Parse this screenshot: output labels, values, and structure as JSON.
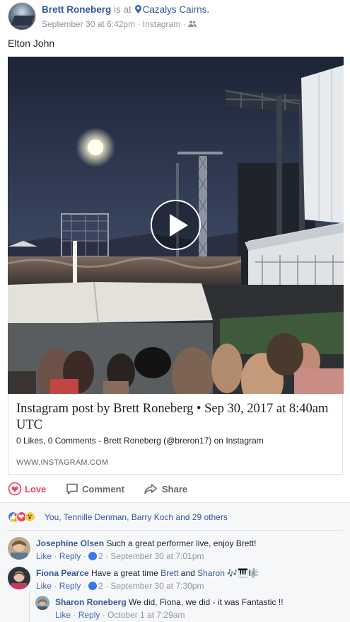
{
  "post": {
    "author": "Brett Roneberg",
    "is_at": "is at",
    "location": "Cazalys Cairns.",
    "time": "September 30 at 6:42pm",
    "via": "Instagram",
    "status_text": "Elton John"
  },
  "attachment": {
    "title": "Instagram post by Brett Roneberg • Sep 30, 2017 at 8:40am UTC",
    "description": "0 Likes, 0 Comments - Brett Roneberg (@breron17) on Instagram",
    "domain": "WWW.INSTAGRAM.COM"
  },
  "actions": {
    "love": "Love",
    "comment": "Comment",
    "share": "Share"
  },
  "reactions": {
    "summary": "You, Tennille Denman, Barry Koch and 29 others"
  },
  "comments": [
    {
      "author": "Josephine Olsen",
      "text": "Such a great performer live, enjoy Brett!",
      "like": "Like",
      "reply": "Reply",
      "likes": "2",
      "time": "September 30 at 7:01pm"
    },
    {
      "author": "Fiona Pearce",
      "text_pre": "Have a great time",
      "mention1": "Brett",
      "and": "and",
      "mention2": "Sharon",
      "notes": "🎶🎹🎼",
      "like": "Like",
      "reply": "Reply",
      "likes": "2",
      "time": "September 30 at 7:30pm"
    },
    {
      "author": "Sharon Roneberg",
      "text": "We did, Fiona, we did - it was Fantastic !!",
      "like": "Like",
      "reply": "Reply",
      "time": "October 1 at 7:29am"
    }
  ],
  "icons": {
    "location": "map-pin-icon",
    "audience": "friends-icon",
    "play": "play-icon",
    "love": "heart-outline-icon",
    "comment": "comment-bubble-icon",
    "share": "share-arrow-icon",
    "reaction_like": "like-reaction-icon",
    "reaction_love": "love-reaction-icon",
    "reaction_wow": "wow-reaction-icon"
  },
  "colors": {
    "link": "#365899",
    "love": "#f33e58",
    "muted": "#90949c",
    "like_blue": "#3b78e7"
  }
}
